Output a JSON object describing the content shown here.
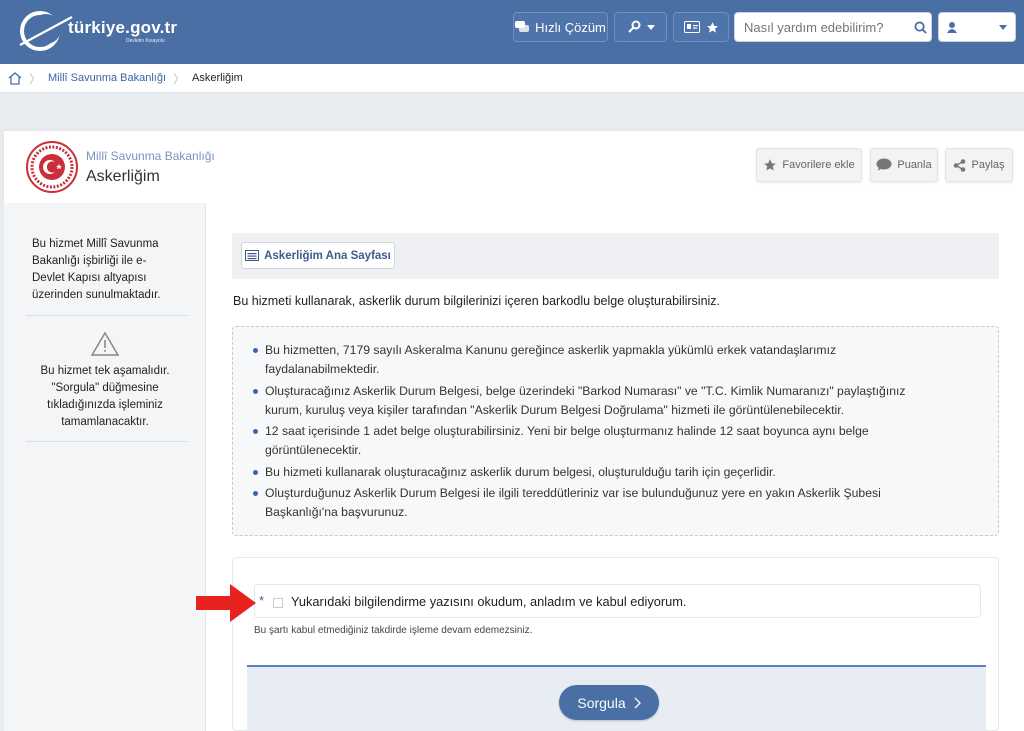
{
  "header": {
    "logo_text": "türkiye.gov.tr",
    "logo_sub": "Devletin Kısayolu",
    "quick_solution": "Hızlı Çözüm",
    "search_placeholder": "Nasıl yardım edebilirim?"
  },
  "breadcrumb": {
    "items": [
      "Millî Savunma Bakanlığı",
      "Askerliğim"
    ]
  },
  "service": {
    "ministry": "Millî Savunma Bakanlığı",
    "title": "Askerliğim",
    "actions": [
      "Favorilere ekle",
      "Puanla",
      "Paylaş"
    ]
  },
  "sidebar": {
    "note1": "Bu hizmet Millî Savunma Bakanlığı işbirliği ile e-Devlet Kapısı altyapısı üzerinden sunulmaktadır.",
    "note2": "Bu hizmet tek aşamalıdır. \"Sorgula\" düğmesine tıkladığınızda işleminiz tamamlanacaktır."
  },
  "main": {
    "subnav_button": "Askerliğim Ana Sayfası",
    "intro": "Bu hizmeti kullanarak, askerlik durum bilgilerinizi içeren barkodlu belge oluşturabilirsiniz.",
    "info_items": [
      "Bu hizmetten, 7179 sayılı Askeralma Kanunu gereğince askerlik yapmakla yükümlü erkek vatandaşlarımız faydalanabilmektedir.",
      "Oluşturacağınız Askerlik Durum Belgesi, belge üzerindeki \"Barkod Numarası\" ve \"T.C. Kimlik Numaranızı\" paylaştığınız kurum, kuruluş veya kişiler tarafından \"Askerlik Durum Belgesi Doğrulama\" hizmeti ile görüntülenebilecektir.",
      "12 saat içerisinde 1 adet belge oluşturabilirsiniz. Yeni bir belge oluşturmanız halinde 12 saat boyunca aynı belge görüntülenecektir.",
      "Bu hizmeti kullanarak oluşturacağınız askerlik durum belgesi, oluşturulduğu tarih için geçerlidir.",
      "Oluşturduğunuz Askerlik Durum Belgesi ile ilgili tereddütleriniz var ise bulunduğunuz yere en yakın Askerlik Şubesi Başkanlığı'na başvurunuz."
    ],
    "required_mark": "*",
    "checkbox_label": "Yukarıdaki bilgilendirme yazısını okudum, anladım ve kabul ediyorum.",
    "warning": "Bu şartı kabul etmediğiniz takdirde işleme devam edemezsiniz.",
    "submit_label": "Sorgula"
  },
  "colors": {
    "header": "#4a6fa5",
    "accent": "#3c64a8",
    "arrow": "#e8231f",
    "emblem": "#cc2d3b"
  }
}
